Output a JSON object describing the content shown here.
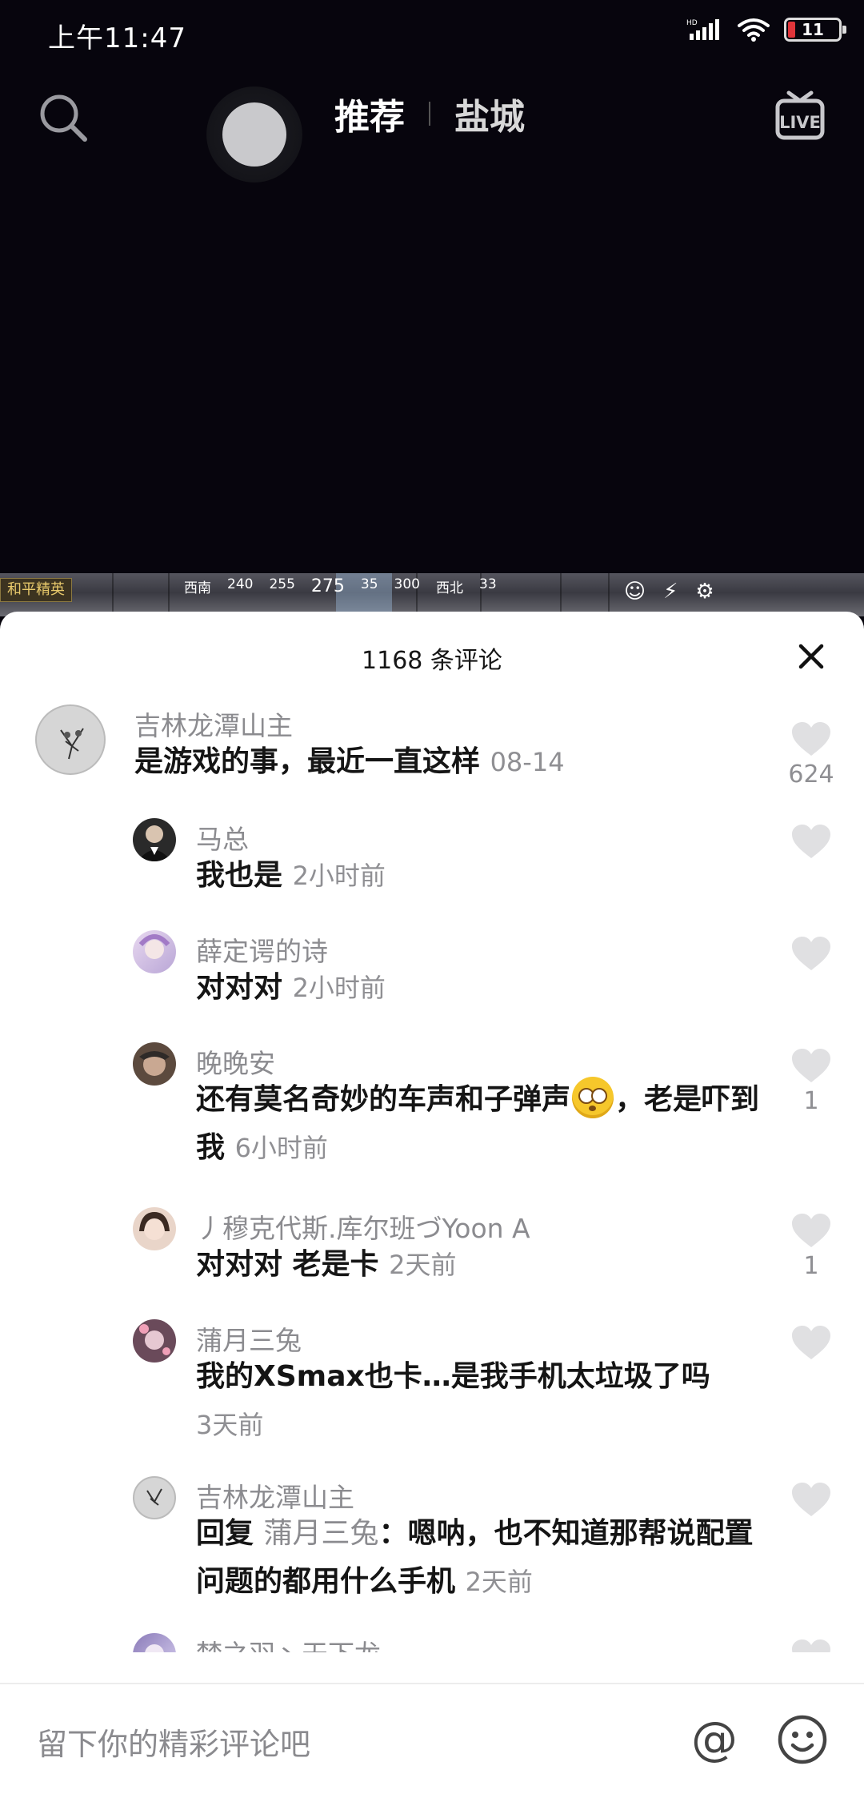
{
  "status_bar": {
    "time": "上午11:47",
    "network": "HD",
    "battery": "11"
  },
  "top_nav": {
    "tabs": [
      {
        "label": "推荐"
      },
      {
        "label": "盐城"
      }
    ],
    "live_label": "LIVE"
  },
  "video_hud": {
    "badge": "和平精英",
    "compass": [
      "西南",
      "240",
      "255",
      "275",
      "35",
      "300",
      "西北",
      "33"
    ]
  },
  "comments_sheet": {
    "title": "1168 条评论",
    "comments": [
      {
        "author": "吉林龙潭山主",
        "text": "是游戏的事，最近一直这样",
        "time": "08-14",
        "likes": "624"
      },
      {
        "author": "马总",
        "text": "我也是",
        "time": "2小时前",
        "likes": ""
      },
      {
        "author": "薛定谔的诗",
        "text": "对对对",
        "time": "2小时前",
        "likes": ""
      },
      {
        "author": "晚晚安",
        "text_before": "还有莫名奇妙的车声和子弹声",
        "text_after": "，老是吓到我",
        "time": "6小时前",
        "likes": "1"
      },
      {
        "author": "丿穆克代斯.库尔班づYoon A",
        "text": "对对对 老是卡",
        "time": "2天前",
        "likes": "1"
      },
      {
        "author": "蒲月三兔",
        "text": "我的XSmax也卡…是我手机太垃圾了吗",
        "time": "3天前",
        "likes": ""
      },
      {
        "author": "吉林龙潭山主",
        "reply_prefix": "回复 ",
        "reply_to": "蒲月三兔",
        "text": "：嗯呐，也不知道那帮说配置问题的都用什么手机",
        "time": "2天前",
        "likes": ""
      },
      {
        "author": "梦之羽丶天下龙",
        "text": "",
        "time": "",
        "likes": ""
      }
    ]
  },
  "input_bar": {
    "placeholder": "留下你的精彩评论吧",
    "at_symbol": "@"
  },
  "colors": {
    "sheet_bg": "#ffffff",
    "video_bg": "#07050d",
    "muted_text": "#8b8b8f",
    "battery_low": "#e0353a"
  }
}
